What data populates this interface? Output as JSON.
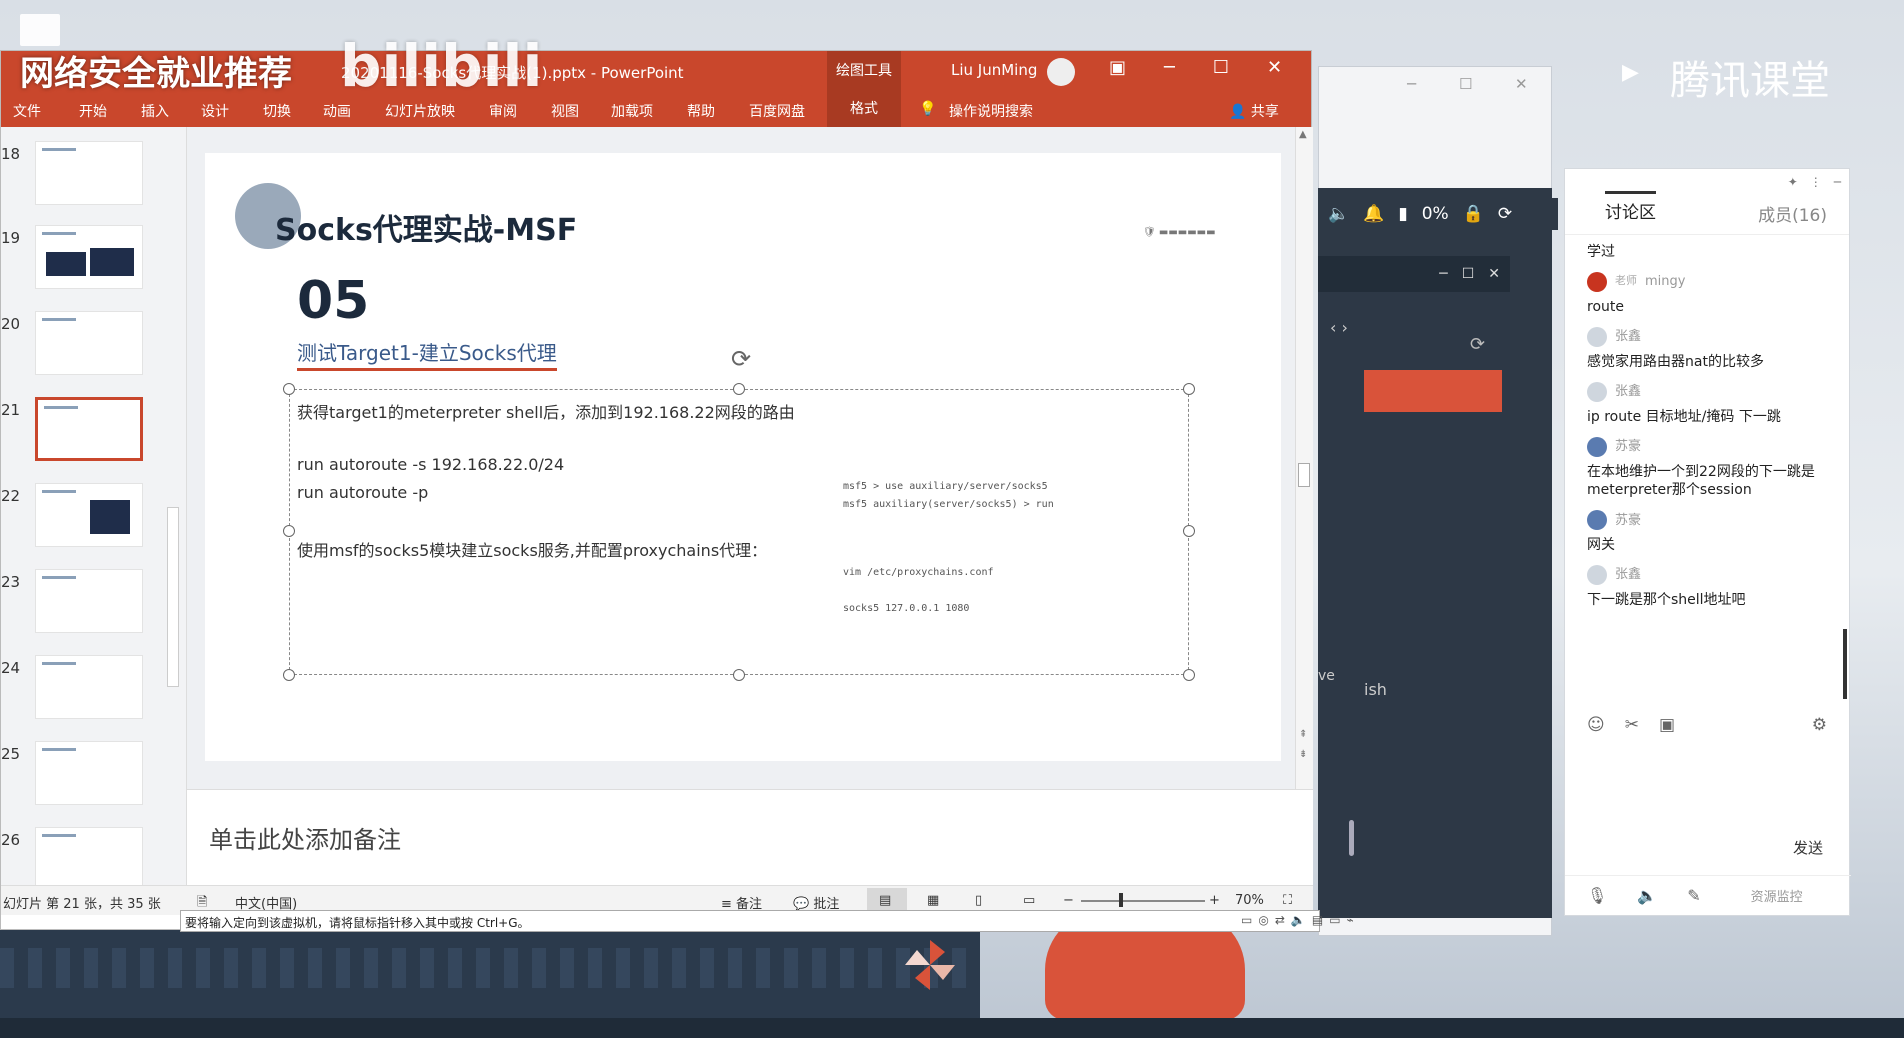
{
  "watermark": {
    "left": "网络安全就业推荐",
    "bili": "bilibili",
    "right": "腾讯课堂",
    "play": "▶"
  },
  "ppt": {
    "title": "20201116-Socks代理实战(1).pptx  -  PowerPoint",
    "contextual_group": "绘图工具",
    "user": "Liu JunMing",
    "window_controls": [
      "▣",
      "─",
      "☐",
      "✕"
    ],
    "ribbon_tabs": [
      "文件",
      "开始",
      "插入",
      "设计",
      "切换",
      "动画",
      "幻灯片放映",
      "审阅",
      "视图",
      "加载项",
      "帮助",
      "百度网盘",
      "格式",
      "操作说明搜索"
    ],
    "share": "共享",
    "thumbnails": [
      "18",
      "19",
      "20",
      "21",
      "22",
      "23",
      "24",
      "25",
      "26"
    ],
    "slide": {
      "title": "Socks代理实战-MSF",
      "number": "05",
      "subtitle": "测试Target1-建立Socks代理",
      "line1": "获得target1的meterpreter shell后，添加到192.168.22网段的路由",
      "line2": "run autoroute -s 192.168.22.0/24",
      "line3": "run autoroute -p",
      "line4": "使用msf的socks5模块建立socks服务,并配置proxychains代理：",
      "code1": "msf5 > use auxiliary/server/socks5",
      "code2": "msf5 auxiliary(server/socks5) > run",
      "code3": "vim /etc/proxychains.conf",
      "code4": "socks5  127.0.0.1 1080"
    },
    "notes_placeholder": "单击此处添加备注",
    "status": {
      "slide_info": "幻灯片 第 21 张，共 35 张",
      "language": "中文(中国)",
      "notes_btn": "备注",
      "comments_btn": "批注",
      "zoom": "70%"
    }
  },
  "vm_bar": {
    "message": "要将输入定向到该虚拟机，请将鼠标指针移入其中或按 Ctrl+G。"
  },
  "tray": {
    "percent": "0%"
  },
  "vm": {
    "text_left": "ve",
    "text_right": "ish",
    "nav": "‹  ›"
  },
  "chat": {
    "tab_active": "讨论区",
    "tab_members": "成员(16)",
    "messages": [
      {
        "text": "学过"
      },
      {
        "who": "mingy",
        "tag": "老师",
        "text": "route"
      },
      {
        "who": "张鑫",
        "text": "感觉家用路由器nat的比较多"
      },
      {
        "who": "张鑫",
        "text": "ip route 目标地址/掩码 下一跳"
      },
      {
        "who": "苏豪",
        "text": "在本地维护一个到22网段的下一跳是meterpreter那个session"
      },
      {
        "who": "苏豪",
        "text": "网关"
      },
      {
        "who": "张鑫",
        "text": "下一跳是那个shell地址吧"
      }
    ],
    "send": "发送",
    "monitor": "资源监控"
  }
}
